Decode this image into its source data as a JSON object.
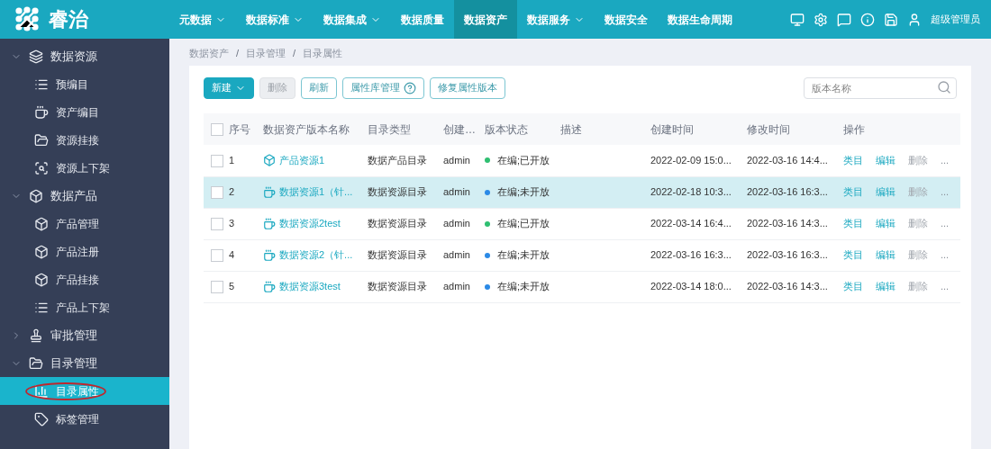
{
  "brand": {
    "name": "睿治"
  },
  "nav": [
    {
      "label": "元数据",
      "dropdown": true,
      "selected": false
    },
    {
      "label": "数据标准",
      "dropdown": true,
      "selected": false
    },
    {
      "label": "数据集成",
      "dropdown": true,
      "selected": false
    },
    {
      "label": "数据质量",
      "dropdown": false,
      "selected": false
    },
    {
      "label": "数据资产",
      "dropdown": false,
      "selected": true
    },
    {
      "label": "数据服务",
      "dropdown": true,
      "selected": false
    },
    {
      "label": "数据安全",
      "dropdown": false,
      "selected": false
    },
    {
      "label": "数据生命周期",
      "dropdown": false,
      "selected": false
    }
  ],
  "user": {
    "name": "超级管理员"
  },
  "sidebar": {
    "groups": [
      {
        "label": "数据资源",
        "expanded": true,
        "children": [
          {
            "label": "预编目",
            "selected": false
          },
          {
            "label": "资产编目",
            "selected": false
          },
          {
            "label": "资源挂接",
            "selected": false
          },
          {
            "label": "资源上下架",
            "selected": false
          }
        ]
      },
      {
        "label": "数据产品",
        "expanded": true,
        "children": [
          {
            "label": "产品管理",
            "selected": false
          },
          {
            "label": "产品注册",
            "selected": false
          },
          {
            "label": "产品挂接",
            "selected": false
          },
          {
            "label": "产品上下架",
            "selected": false
          }
        ]
      },
      {
        "label": "审批管理",
        "expanded": false
      },
      {
        "label": "目录管理",
        "expanded": true,
        "children": [
          {
            "label": "目录属性",
            "selected": true
          },
          {
            "label": "标签管理",
            "selected": false
          }
        ]
      }
    ]
  },
  "breadcrumb": {
    "separator": "/",
    "items": [
      "数据资产",
      "目录管理",
      "目录属性"
    ]
  },
  "toolbar": {
    "buttons": [
      {
        "label": "新建",
        "kind": "primary",
        "disabled": false
      },
      {
        "label": "删除",
        "kind": "plain",
        "disabled": true
      },
      {
        "label": "刷新",
        "kind": "plain",
        "disabled": false
      },
      {
        "label": "属性库管理",
        "kind": "help",
        "disabled": false
      },
      {
        "label": "修复属性版本",
        "kind": "plain",
        "disabled": false
      }
    ],
    "search": {
      "placeholder": "版本名称"
    }
  },
  "table": {
    "all_checked": false,
    "columns": [
      "序号",
      "数据资产版本名称",
      "目录类型",
      "创建…",
      "版本状态",
      "描述",
      "创建时间",
      "修改时间",
      "操作"
    ],
    "rows": [
      {
        "index": "1",
        "name": "产品资源1",
        "kind": "product",
        "type": "数据产品目录",
        "creator": "admin",
        "status": "在编;已开放",
        "color": "#2fbf71",
        "created": "2022-02-09 15:0...",
        "modified": "2022-03-16 14:4...",
        "selected": false,
        "checked": false,
        "actions": [
          "类目",
          "编辑",
          "删除",
          "..."
        ]
      },
      {
        "index": "2",
        "name": "数据资源1（针...",
        "kind": "resource",
        "type": "数据资源目录",
        "creator": "admin",
        "status": "在编;未开放",
        "color": "#2b8ae6",
        "created": "2022-02-18 10:3...",
        "modified": "2022-03-16 16:3...",
        "selected": true,
        "checked": false,
        "actions": [
          "类目",
          "编辑",
          "删除",
          "..."
        ]
      },
      {
        "index": "3",
        "name": "数据资源2test",
        "kind": "resource",
        "type": "数据资源目录",
        "creator": "admin",
        "status": "在编;已开放",
        "color": "#2fbf71",
        "created": "2022-03-14 16:4...",
        "modified": "2022-03-16 14:3...",
        "selected": false,
        "checked": false,
        "actions": [
          "类目",
          "编辑",
          "删除",
          "..."
        ]
      },
      {
        "index": "4",
        "name": "数据资源2（针...",
        "kind": "resource",
        "type": "数据资源目录",
        "creator": "admin",
        "status": "在编;未开放",
        "color": "#2b8ae6",
        "created": "2022-03-16 16:3...",
        "modified": "2022-03-16 16:3...",
        "selected": false,
        "checked": false,
        "actions": [
          "类目",
          "编辑",
          "删除",
          "..."
        ]
      },
      {
        "index": "5",
        "name": "数据资源3test",
        "kind": "resource",
        "type": "数据资源目录",
        "creator": "admin",
        "status": "在编;未开放",
        "color": "#2b8ae6",
        "created": "2022-03-14 18:0...",
        "modified": "2022-03-16 14:3...",
        "selected": false,
        "checked": false,
        "actions": [
          "类目",
          "编辑",
          "删除",
          "..."
        ]
      }
    ]
  }
}
